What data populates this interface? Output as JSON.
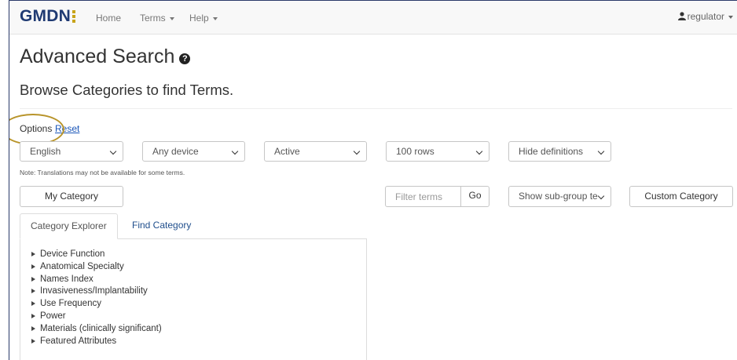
{
  "navbar": {
    "logo": "GMDN",
    "links": [
      {
        "label": "Home",
        "dropdown": false
      },
      {
        "label": "Terms",
        "dropdown": true
      },
      {
        "label": "Help",
        "dropdown": true
      }
    ],
    "user": {
      "label": "regulator",
      "icon": "user-icon"
    }
  },
  "page": {
    "title": "Advanced Search",
    "title_icon": "question-circle-icon",
    "subtitle": "Browse Categories to find Terms."
  },
  "options": {
    "options_label": "Options",
    "reset_label": "Reset",
    "filters": [
      {
        "name": "language",
        "value": "English"
      },
      {
        "name": "device-type",
        "value": "Any device"
      },
      {
        "name": "status",
        "value": "Active"
      },
      {
        "name": "rows",
        "value": "100 rows"
      },
      {
        "name": "definitions",
        "value": "Hide definitions"
      }
    ],
    "note": "Note: Translations may not be available for some terms."
  },
  "actions": {
    "my_category": "My Category",
    "filter_placeholder": "Filter terms",
    "go": "Go",
    "subgroup_value": "Show sub-group te",
    "custom_category": "Custom Category"
  },
  "tabs": [
    {
      "label": "Category Explorer",
      "active": true
    },
    {
      "label": "Find Category",
      "active": false
    }
  ],
  "tree": [
    "Device Function",
    "Anatomical Specialty",
    "Names Index",
    "Invasiveness/Implantability",
    "Use Frequency",
    "Power",
    "Materials (clinically significant)",
    "Featured Attributes"
  ],
  "colors": {
    "logo": "#1f3a72",
    "logo_accent": "#c8a41a",
    "link": "#1a56b8",
    "highlight_circle": "#b8942a"
  }
}
